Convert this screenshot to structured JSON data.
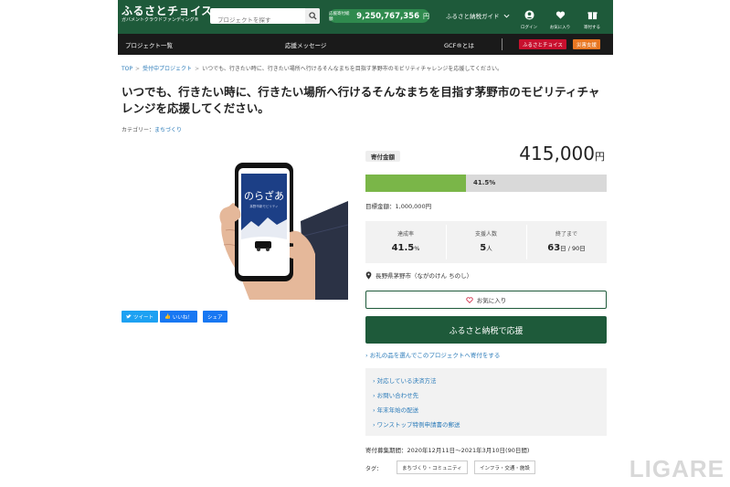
{
  "header": {
    "logo_main": "ふるさとチョイス",
    "logo_sub": "ガバメントクラウドファンディング®",
    "search_placeholder": "プロジェクトを探す",
    "total_label": "応援寄付総額",
    "total_value": "9,250,767,356",
    "total_unit": "円",
    "guide": "ふるさと納税ガイド",
    "icons": [
      {
        "name": "login",
        "label": "ログイン",
        "icon": "user-icon"
      },
      {
        "name": "favorites",
        "label": "お気に入り",
        "icon": "heart-icon"
      },
      {
        "name": "donation-list",
        "label": "寄付する",
        "icon": "gift-icon"
      }
    ],
    "brand_color": "#1e5a3a"
  },
  "nav": {
    "items": [
      "プロジェクト一覧",
      "応援メッセージ",
      "GCF®とは"
    ],
    "btn_furusato": "ふるさとチョイス",
    "btn_disaster": "災害支援"
  },
  "breadcrumb": {
    "top": "TOP",
    "accepting": "受付中プロジェクト",
    "current": "いつでも、行きたい時に、行きたい場所へ行けるそんなまちを目指す茅野市のモビリティチャレンジを応援してください。"
  },
  "page": {
    "title": "いつでも、行きたい時に、行きたい場所へ行けるそんなまちを目指す茅野市のモビリティチャレンジを応援してください。",
    "category_label": "カテゴリー：",
    "category_value": "まちづくり"
  },
  "image": {
    "app_name": "のらざあ",
    "app_sub": "茅野市新モビリティ"
  },
  "share": {
    "tweet": "ツイート",
    "like": "いいね！",
    "share": "シェア"
  },
  "donation": {
    "label": "寄付金額",
    "amount": "415,000",
    "unit": "円",
    "progress_text": "41.5%",
    "progress_fraction": 0.415,
    "target": "目標金額：1,000,000円"
  },
  "stats": [
    {
      "key": "達成率",
      "value": "41.5",
      "unit": "%"
    },
    {
      "key": "支援人数",
      "value": "5",
      "unit": "人"
    },
    {
      "key": "終了まで",
      "value": "63",
      "unit": "日 / 90日"
    }
  ],
  "location": "長野県茅野市（ながのけん ちのし）",
  "favorite_label": "お気に入り",
  "cta": "ふるさと納税で応援",
  "gift_link": "お礼の品を選んでこのプロジェクトへ寄付をする",
  "info_links": [
    "対応している決済方法",
    "お問い合わせ先",
    "年末年始の配送",
    "ワンストップ特例申請書の郵送"
  ],
  "period": "寄付募集期間：2020年12月11日～2021年3月10日(90日間)",
  "tags_label": "タグ：",
  "tags": [
    "まちづくり・コミュニティ",
    "インフラ・交通・施設"
  ],
  "watermark": "LIGARE"
}
